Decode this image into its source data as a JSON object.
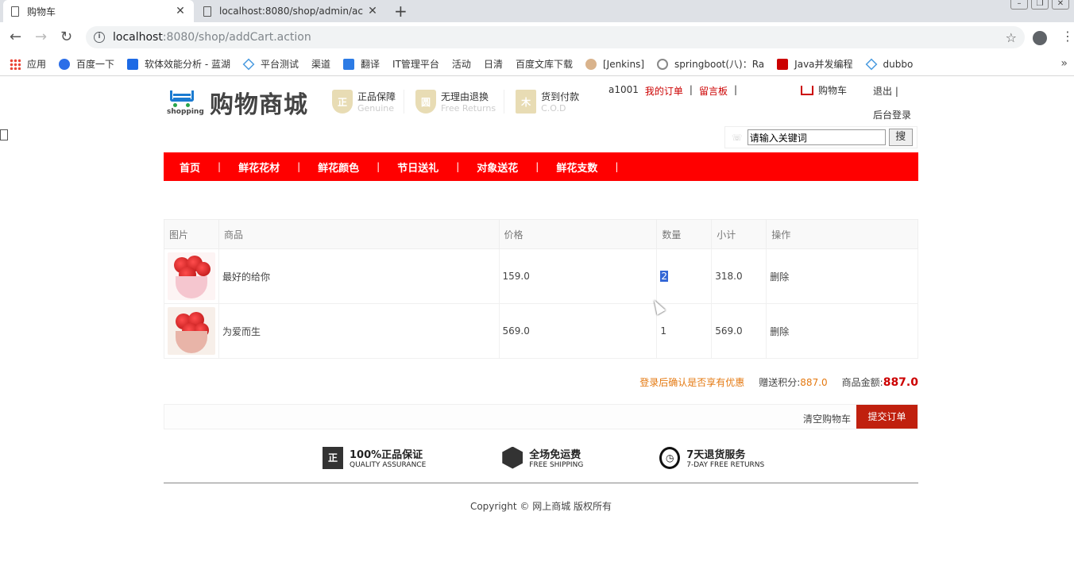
{
  "browser": {
    "tabs": [
      {
        "title": "购物车"
      },
      {
        "title": "localhost:8080/shop/admin/ac"
      }
    ],
    "url_host": "localhost",
    "url_rest": ":8080/shop/addCart.action",
    "bookmarks": [
      {
        "label": "应用",
        "icon": "apps-icon"
      },
      {
        "label": "百度一下",
        "icon": "baidu-icon"
      },
      {
        "label": "软体效能分析 - 蓝湖",
        "icon": "lanhu-icon"
      },
      {
        "label": "平台测试",
        "icon": "diamond-icon"
      },
      {
        "label": "渠道",
        "icon": "page-icon"
      },
      {
        "label": "翻译",
        "icon": "translate-icon"
      },
      {
        "label": "IT管理平台",
        "icon": "page-icon"
      },
      {
        "label": "活动",
        "icon": "page-icon"
      },
      {
        "label": "日清",
        "icon": "page-icon"
      },
      {
        "label": "百度文库下载",
        "icon": "page-icon"
      },
      {
        "label": "[Jenkins]",
        "icon": "jenkins-icon"
      },
      {
        "label": "springboot(八)：Ra",
        "icon": "springboot-icon"
      },
      {
        "label": "Java并发编程",
        "icon": "java-icon"
      },
      {
        "label": "dubbo",
        "icon": "diamond-icon"
      }
    ]
  },
  "header": {
    "logo_sub": "shopping",
    "logo_name": "购物商城",
    "badges": [
      {
        "mark": "正",
        "title": "正品保障",
        "sub": "Genuine"
      },
      {
        "mark": "圆",
        "title": "无理由退换",
        "sub": "Free Returns"
      },
      {
        "mark": "木",
        "title": "货到付款",
        "sub": "C.O.D"
      }
    ],
    "user": "a1001",
    "my_orders": "我的订单",
    "message_board": "留言板",
    "cart": "购物车",
    "logout": "退出",
    "admin_login": "后台登录",
    "search_value": "请输入关键词",
    "search_button": "搜"
  },
  "nav": [
    "首页",
    "鲜花花材",
    "鲜花颜色",
    "节日送礼",
    "对象送花",
    "鲜花支数"
  ],
  "cart": {
    "columns": [
      "图片",
      "商品",
      "价格",
      "数量",
      "小计",
      "操作"
    ],
    "rows": [
      {
        "name": "最好的给你",
        "price": "159.0",
        "qty": "2",
        "subtotal": "318.0",
        "action": "删除"
      },
      {
        "name": "为爱而生",
        "price": "569.0",
        "qty": "1",
        "subtotal": "569.0",
        "action": "删除"
      }
    ],
    "promo_hint": "登录后确认是否享有优惠",
    "points_label": "赠送积分:",
    "points": "887.0",
    "amount_label": "商品金额:",
    "amount": "887.0",
    "clear": "清空购物车",
    "submit": "提交订单"
  },
  "services": [
    {
      "mark": "正",
      "title": "100%正品保证",
      "sub": "QUALITY ASSURANCE"
    },
    {
      "mark": "",
      "title": "全场免运费",
      "sub": "FREE SHIPPING"
    },
    {
      "mark": "",
      "title": "7天退货服务",
      "sub": "7-DAY FREE RETURNS"
    }
  ],
  "footer": {
    "copyright": "Copyright © 网上商城 版权所有"
  },
  "colors": {
    "nav_red": "#ff0000",
    "submit_red": "#c0200e",
    "accent_orange": "#e47911"
  }
}
